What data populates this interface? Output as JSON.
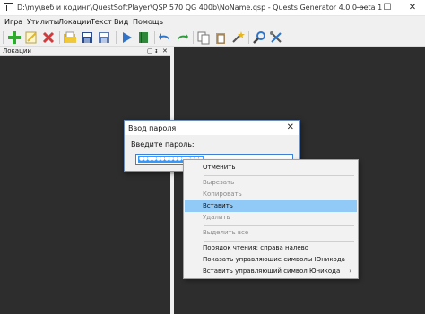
{
  "window": {
    "title": "D:\\my\\веб и кодинг\\QuestSoftPlayer\\QSP 570 QG 400b\\NoName.qsp - Quests Generator 4.0.0 beta 1",
    "buttons": {
      "minimize": "—",
      "maximize": "☐",
      "close": "✕"
    }
  },
  "menubar": [
    "Игра",
    "Утилиты",
    "Локации",
    "Текст",
    "Вид",
    "Помощь"
  ],
  "toolbar": {
    "icons": [
      "add-location-icon",
      "edit-icon",
      "delete-icon",
      "open-folder-icon",
      "save-icon",
      "save-as-icon",
      "play-icon",
      "book-icon",
      "undo-icon",
      "redo-icon",
      "copy-icon",
      "paste-icon",
      "wand-icon",
      "search-icon",
      "settings-icon"
    ],
    "colors": {
      "green": "#2eaa2e",
      "red": "#d23b3b",
      "blue": "#2f74c8",
      "yellow": "#e5b620",
      "navy": "#2a4a8a"
    }
  },
  "locations_panel": {
    "title": "Локации",
    "controls": {
      "list": "▢",
      "pin": "ᵻ",
      "close": "✕"
    }
  },
  "dialog": {
    "title": "Ввод пароля",
    "close": "✕",
    "label": "Введите пароль:",
    "password_value": "●●●●●●●●●●●●●●●"
  },
  "context_menu": {
    "items": [
      {
        "label": "Отменить",
        "enabled": true
      },
      {
        "label": "Вырезать",
        "enabled": false
      },
      {
        "label": "Копировать",
        "enabled": false
      },
      {
        "label": "Вставить",
        "enabled": true,
        "highlighted": true
      },
      {
        "label": "Удалить",
        "enabled": false
      },
      {
        "label": "Выделить все",
        "enabled": false
      },
      {
        "label": "Порядок чтения: справа налево",
        "enabled": true
      },
      {
        "label": "Показать управляющие символы Юникода",
        "enabled": true
      },
      {
        "label": "Вставить управляющий символ Юникода",
        "enabled": true,
        "submenu": "›"
      }
    ]
  }
}
